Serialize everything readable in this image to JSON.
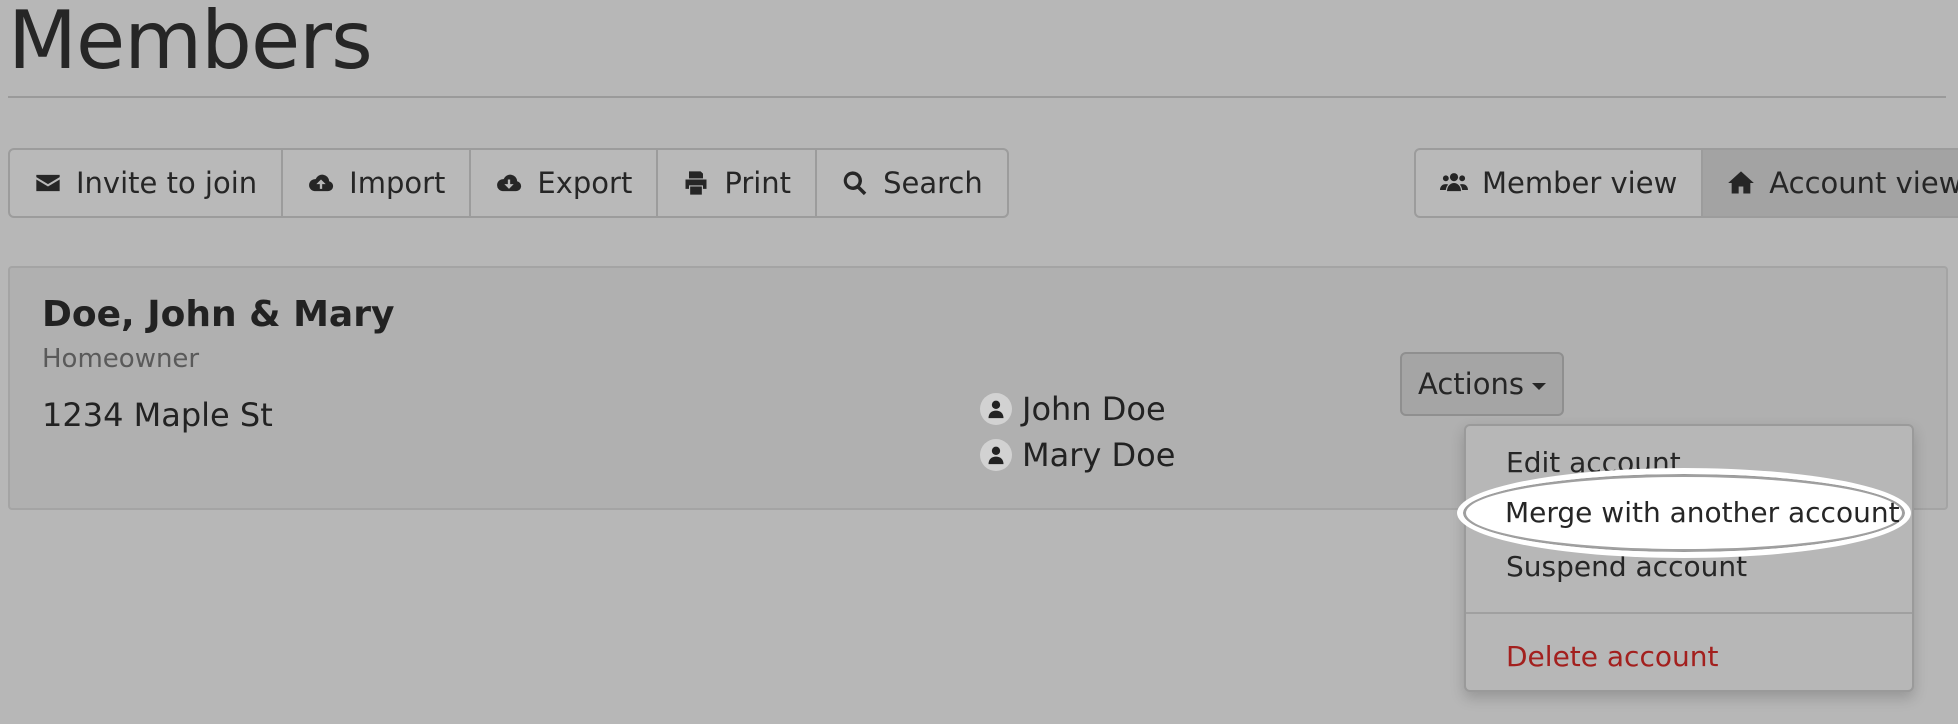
{
  "page": {
    "title": "Members"
  },
  "toolbar": {
    "left": [
      {
        "label": "Invite to join",
        "icon": "envelope-icon"
      },
      {
        "label": "Import",
        "icon": "cloud-upload-icon"
      },
      {
        "label": "Export",
        "icon": "cloud-download-icon"
      },
      {
        "label": "Print",
        "icon": "print-icon"
      },
      {
        "label": "Search",
        "icon": "search-icon"
      }
    ],
    "right": [
      {
        "label": "Member view",
        "icon": "users-icon",
        "active": false
      },
      {
        "label": "Account view",
        "icon": "home-icon",
        "active": true
      }
    ]
  },
  "account": {
    "name": "Doe, John & Mary",
    "type": "Homeowner",
    "address": "1234 Maple St",
    "members": [
      {
        "name": "John Doe",
        "icon": "user-icon"
      },
      {
        "name": "Mary Doe",
        "icon": "user-icon"
      }
    ],
    "actions_label": "Actions"
  },
  "actions_menu": {
    "items": [
      {
        "label": "Edit account"
      },
      {
        "label": "Merge with another account",
        "highlighted": true
      },
      {
        "label": "Suspend account"
      }
    ],
    "danger_item": {
      "label": "Delete account",
      "color": "#a3201e"
    }
  }
}
